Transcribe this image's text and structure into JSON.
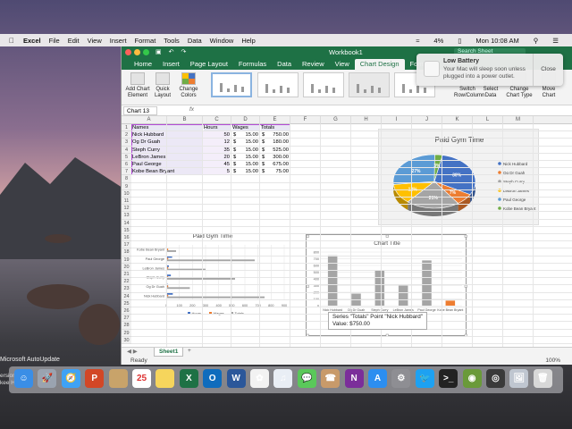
{
  "menubar": {
    "app": "Excel",
    "items": [
      "File",
      "Edit",
      "View",
      "Insert",
      "Format",
      "Tools",
      "Data",
      "Window",
      "Help"
    ],
    "battery": "4%",
    "clock": "Mon 10:08 AM"
  },
  "window": {
    "title": "Workbook1",
    "search_placeholder": "Search Sheet"
  },
  "ribbon_tabs": [
    "Home",
    "Insert",
    "Page Layout",
    "Formulas",
    "Data",
    "Review",
    "View",
    "Chart Design",
    "Forma"
  ],
  "ribbon": {
    "add_chart_element": "Add Chart Element",
    "quick_layout": "Quick Layout",
    "change_colors": "Change Colors",
    "switch_row_column": "Switch Row/Column",
    "select_data": "Select Data",
    "change_chart_type": "Change Chart Type",
    "move_chart": "Move Chart"
  },
  "formula_bar": {
    "name_box": "Chart 13",
    "fx": "fx"
  },
  "columns": [
    "A",
    "B",
    "C",
    "D",
    "E",
    "F",
    "G",
    "H",
    "I",
    "J",
    "K",
    "L",
    "M"
  ],
  "rows": [
    "1",
    "2",
    "3",
    "4",
    "5",
    "6",
    "7",
    "8",
    "9",
    "10",
    "11",
    "12",
    "13",
    "14",
    "15",
    "16",
    "17",
    "18",
    "19",
    "20",
    "21",
    "22",
    "23",
    "24",
    "25",
    "26",
    "27",
    "28",
    "29",
    "30"
  ],
  "table": {
    "headers": [
      "Names",
      "Hours",
      "Wages",
      "Totals"
    ],
    "rows": [
      {
        "name": "Nick Hubbard",
        "hours": "50",
        "cur1": "$",
        "wage": "15.00",
        "cur2": "$",
        "total": "750.00"
      },
      {
        "name": "Og Dr Guah",
        "hours": "12",
        "cur1": "$",
        "wage": "15.00",
        "cur2": "$",
        "total": "180.00"
      },
      {
        "name": "Steph Curry",
        "hours": "35",
        "cur1": "$",
        "wage": "15.00",
        "cur2": "$",
        "total": "525.00"
      },
      {
        "name": "LeBron James",
        "hours": "20",
        "cur1": "$",
        "wage": "15.00",
        "cur2": "$",
        "total": "300.00"
      },
      {
        "name": "Paul George",
        "hours": "45",
        "cur1": "$",
        "wage": "15.00",
        "cur2": "$",
        "total": "675.00"
      },
      {
        "name": "Kobe Bean Bryant",
        "hours": "5",
        "cur1": "$",
        "wage": "15.00",
        "cur2": "$",
        "total": "75.00"
      }
    ]
  },
  "chart_data": [
    {
      "type": "pie",
      "title": "Paid Gym Time",
      "categories": [
        "Nick Hubbard",
        "Og Dr Guah",
        "Steph Curry",
        "LeBron James",
        "Paul George",
        "Kobe Bean Bryant"
      ],
      "values": [
        30,
        7,
        21,
        12,
        27,
        3
      ],
      "colors": [
        "#4472c4",
        "#ed7d31",
        "#a5a5a5",
        "#ffc000",
        "#5b9bd5",
        "#70ad47"
      ],
      "legend_position": "right"
    },
    {
      "type": "bar",
      "orientation": "horizontal",
      "title": "Paid Gym Time",
      "categories": [
        "Kobe Bean Bryant",
        "Paul George",
        "LeBron James",
        "Steph Curry",
        "Og Dr Guah",
        "Nick Hubbard"
      ],
      "series": [
        {
          "name": "Hours",
          "values": [
            5,
            45,
            20,
            35,
            12,
            50
          ]
        },
        {
          "name": "Wages",
          "values": [
            15,
            15,
            15,
            15,
            15,
            15
          ]
        },
        {
          "name": "Totals",
          "values": [
            75,
            675,
            300,
            525,
            180,
            750
          ]
        }
      ],
      "xlim": [
        0,
        900
      ],
      "xticks": [
        "0",
        "100",
        "200",
        "300",
        "400",
        "500",
        "600",
        "700",
        "800",
        "900"
      ],
      "colors": [
        "#4472c4",
        "#ed7d31",
        "#a5a5a5"
      ],
      "legend_position": "bottom"
    },
    {
      "type": "bar",
      "title": "Chart Title",
      "categories": [
        "Nick Hubbard",
        "Og Dr Guah",
        "Steph Curry",
        "LeBron James",
        "Paul George",
        "Kobe Bean Bryant"
      ],
      "values": [
        750,
        180,
        525,
        300,
        675,
        75
      ],
      "ylim": [
        0,
        800
      ],
      "yticks": [
        "0",
        "100",
        "200",
        "300",
        "400",
        "500",
        "600",
        "700",
        "800"
      ],
      "colors": [
        "#a5a5a5"
      ],
      "highlight_color": "#ed7d31"
    }
  ],
  "tooltip": {
    "line1": "Series \"Totals\" Point \"Nick Hubbard\"",
    "line2": "Value: $750.00"
  },
  "notification": {
    "title": "Low Battery",
    "body": "Your Mac will sleep soon unless plugged into a power outlet.",
    "close": "Close"
  },
  "sheet_tab": "Sheet1",
  "status": {
    "ready": "Ready",
    "zoom": "100%"
  },
  "desktop": {
    "autoupdate": "Microsoft AutoUpdate",
    "stub1": "ersion",
    "stub2": "kee He"
  },
  "dock": {
    "calendar_day": "25",
    "apps": [
      "Finder",
      "Launchpad",
      "Safari",
      "PowerPoint",
      "Finder Folder",
      "Calendar",
      "Notes",
      "Excel",
      "Outlook",
      "Word",
      "Photos",
      "iTunes",
      "Messages",
      "Contacts",
      "OneNote",
      "App Store",
      "System Preferences",
      "Twitter",
      "Terminal",
      "Compressor",
      "Camera",
      "Preview",
      "Trash"
    ]
  }
}
